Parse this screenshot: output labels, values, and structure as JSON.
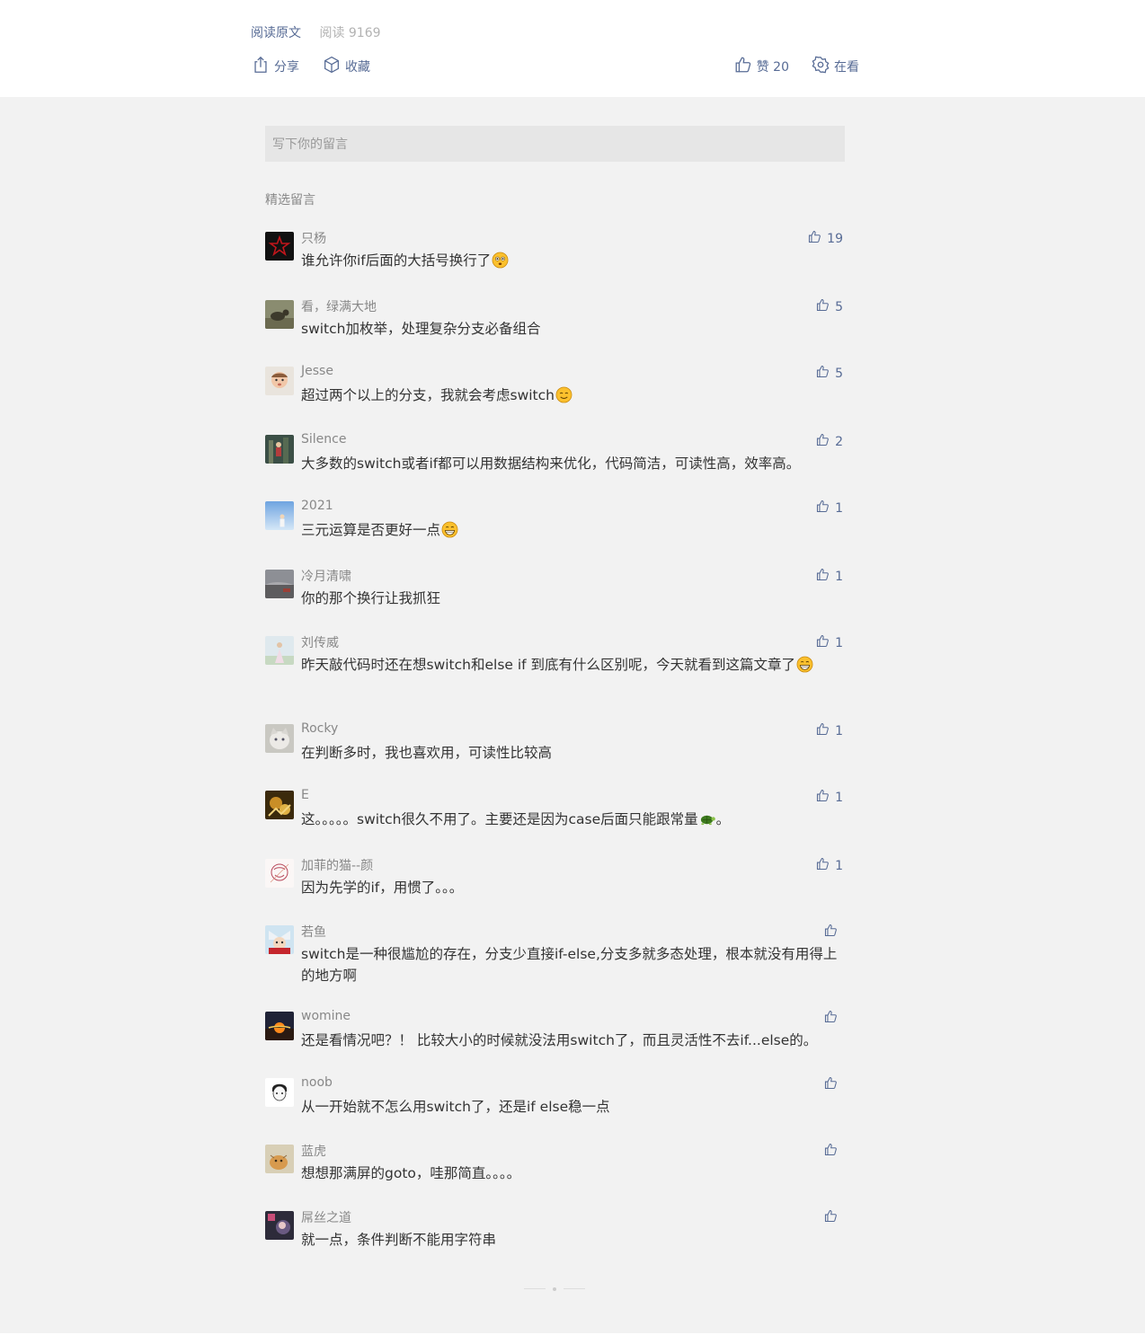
{
  "header": {
    "read_original": "阅读原文",
    "read_count": "阅读 9169",
    "share_label": "分享",
    "collect_label": "收藏",
    "like_label": "赞 20",
    "watch_label": "在看"
  },
  "comment_box": {
    "placeholder": "写下你的留言"
  },
  "section_title": "精选留言",
  "comments": [
    {
      "nick": "只杨",
      "text": "谁允许你if后面的大括号换行了",
      "likes": "19",
      "emoji": "flushed"
    },
    {
      "nick": "看，绿满大地",
      "text": "switch加枚举，处理复杂分支必备组合",
      "likes": "5",
      "emoji": ""
    },
    {
      "nick": "Jesse",
      "text": "超过两个以上的分支，我就会考虑switch",
      "likes": "5",
      "emoji": "smile"
    },
    {
      "nick": "Silence",
      "text": "大多数的switch或者if都可以用数据结构来优化，代码简洁，可读性高，效率高。",
      "likes": "2",
      "emoji": ""
    },
    {
      "nick": "2021",
      "text": "三元运算是否更好一点",
      "likes": "1",
      "emoji": "grin"
    },
    {
      "nick": "冷月清啸",
      "text": "你的那个换行让我抓狂",
      "likes": "1",
      "emoji": ""
    },
    {
      "nick": "刘传威",
      "text": "昨天敲代码时还在想switch和else if 到底有什么区别呢，今天就看到这篇文章了",
      "likes": "1",
      "emoji": "grin"
    },
    {
      "nick": "Rocky",
      "text": "在判断多时，我也喜欢用，可读性比较高",
      "likes": "1",
      "emoji": ""
    },
    {
      "nick": "E",
      "text": "这。。。。。switch很久不用了。主要还是因为case后面只能跟常量",
      "text_after": "。",
      "likes": "1",
      "emoji": "turtle"
    },
    {
      "nick": "加菲的猫--颜",
      "text": "因为先学的if，用惯了。。。",
      "likes": "1",
      "emoji": ""
    },
    {
      "nick": "若鱼",
      "text": "switch是一种很尴尬的存在，分支少直接if-else,分支多就多态处理，根本就没有用得上的地方啊",
      "likes": "",
      "emoji": ""
    },
    {
      "nick": "womine",
      "text": "还是看情况吧？！ 比较大小的时候就没法用switch了，而且灵活性不去if...else的。",
      "likes": "",
      "emoji": ""
    },
    {
      "nick": "noob",
      "text": "从一开始就不怎么用switch了，还是if   else稳一点",
      "likes": "",
      "emoji": ""
    },
    {
      "nick": "蓝虎",
      "text": "想想那满屏的goto，哇那简直。。。。",
      "likes": "",
      "emoji": ""
    },
    {
      "nick": "屌丝之道",
      "text": "就一点，条件判断不能用字符串",
      "likes": "",
      "emoji": ""
    }
  ],
  "colors": {
    "link": "#576b95",
    "background": "#f2f2f2",
    "input_bg": "#e6e6e6",
    "muted": "#888888"
  }
}
